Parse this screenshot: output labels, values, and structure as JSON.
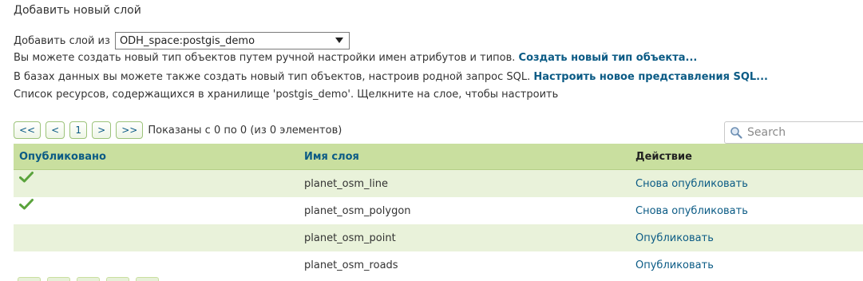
{
  "header": {
    "title": "Добавить новый слой"
  },
  "store": {
    "label": "Добавить слой из",
    "selected": "ODH_space:postgis_demo"
  },
  "info": {
    "line1_text": "Вы можете создать новый тип объектов путем ручной настройки имен атрибутов и типов.",
    "line1_link": "Создать новый тип объекта...",
    "line2_text": "В базах данных вы можете также создать новый тип объектов, настроив родной запрос SQL.",
    "line2_link": "Настроить новое представления SQL...",
    "line3_text": "Список ресурсов, содержащихся в хранилище 'postgis_demo'. Щелкните на слое, чтобы настроить"
  },
  "pager": {
    "first": "<<",
    "prev": "<",
    "page": "1",
    "next": ">",
    "last": ">>",
    "summary": "Показаны с 0 по 0 (из 0 элементов)"
  },
  "search": {
    "placeholder": "Search"
  },
  "table": {
    "headers": {
      "published": "Опубликовано",
      "layer_name": "Имя слоя",
      "action": "Действие"
    },
    "rows": [
      {
        "published": true,
        "layer_name": "planet_osm_line",
        "action": "Снова опубликовать"
      },
      {
        "published": true,
        "layer_name": "planet_osm_polygon",
        "action": "Снова опубликовать"
      },
      {
        "published": false,
        "layer_name": "planet_osm_point",
        "action": "Опубликовать"
      },
      {
        "published": false,
        "layer_name": "planet_osm_roads",
        "action": "Опубликовать"
      }
    ]
  },
  "icons": {
    "check": "checkmark-icon",
    "search": "magnifier-icon",
    "dropdown": "chevron-down-icon"
  },
  "colors": {
    "header_bg": "#c9df9f",
    "alt_row_bg": "#e9f2da",
    "link": "#0b5b85",
    "check_green": "#5aa33c"
  }
}
